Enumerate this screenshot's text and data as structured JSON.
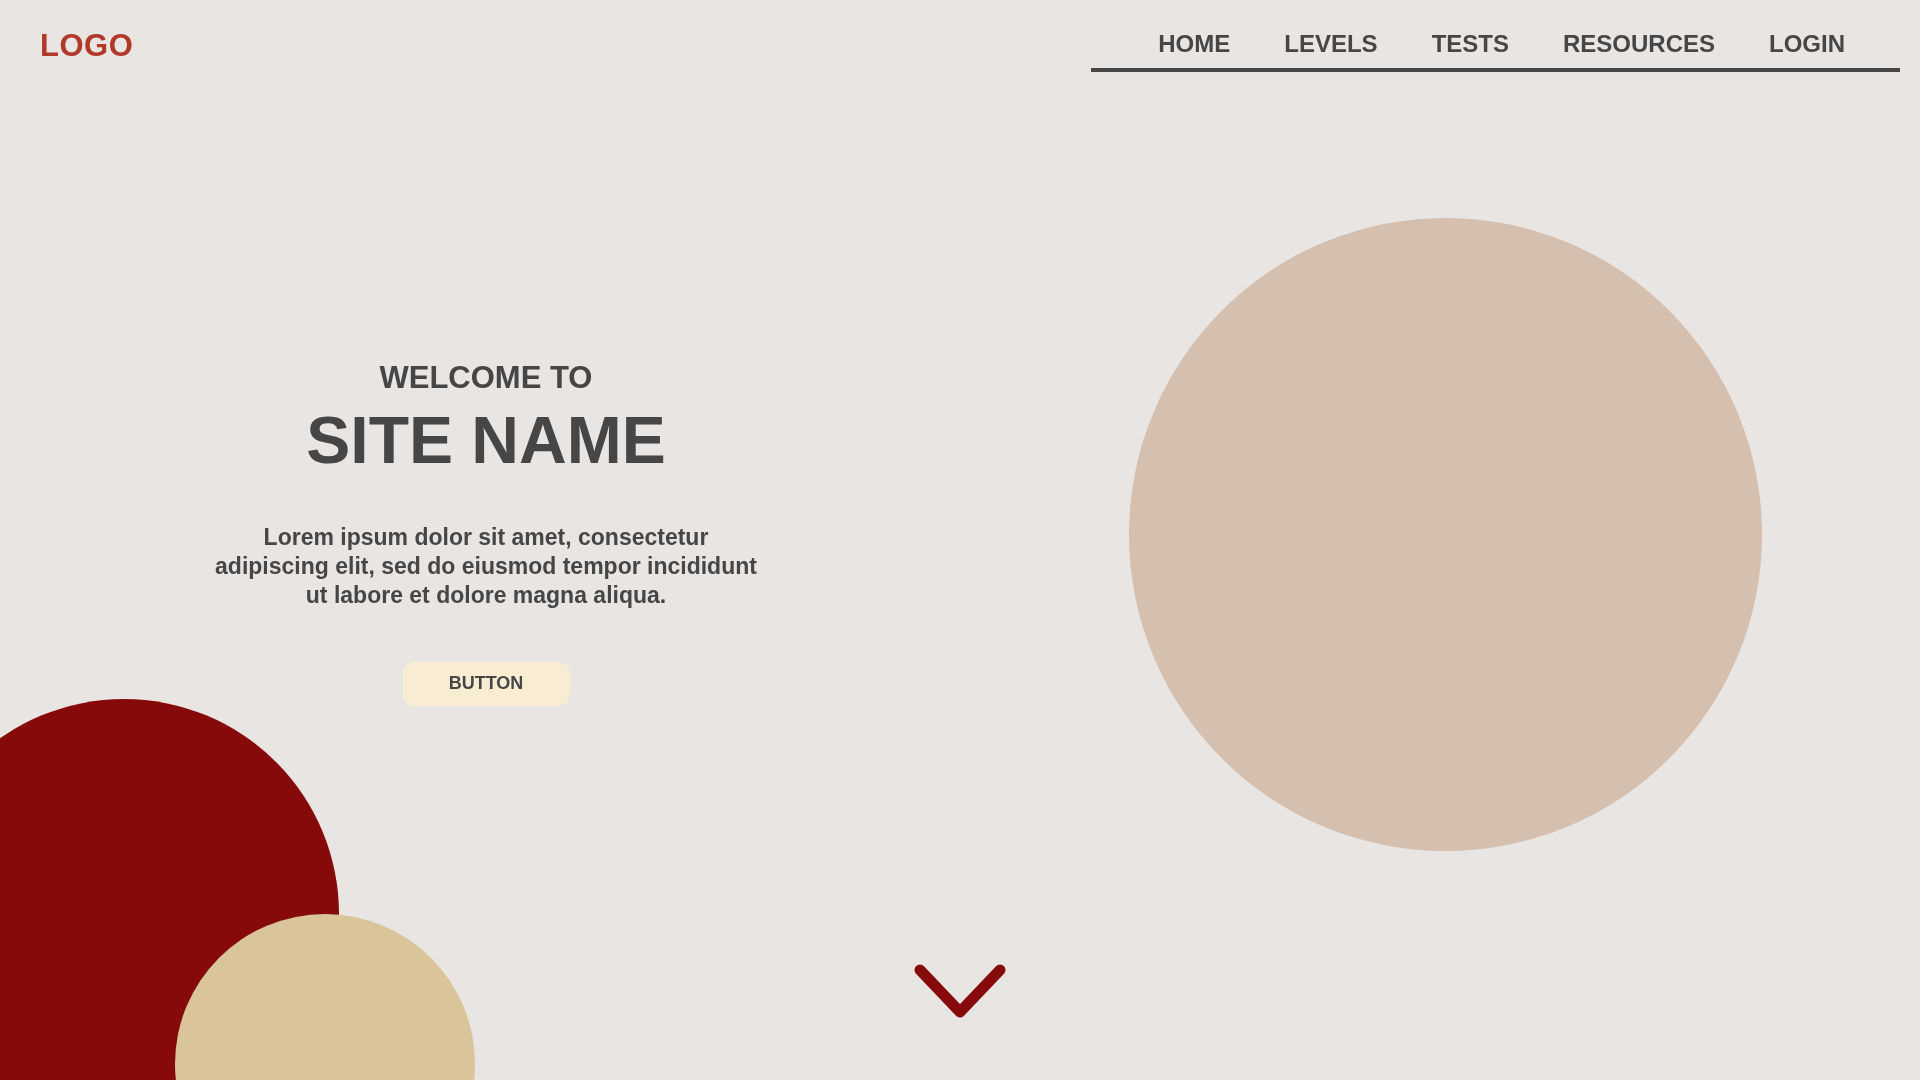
{
  "header": {
    "logo": "LOGO",
    "nav": [
      {
        "label": "HOME"
      },
      {
        "label": "LEVELS"
      },
      {
        "label": "TESTS"
      },
      {
        "label": "RESOURCES"
      },
      {
        "label": "LOGIN"
      }
    ]
  },
  "hero": {
    "kicker": "WELCOME TO",
    "title": "SITE NAME",
    "text": "Lorem ipsum dolor sit amet, consectetur adipiscing elit, sed do eiusmod tempor incididunt ut labore et dolore magna aliqua.",
    "button": "BUTTON"
  }
}
